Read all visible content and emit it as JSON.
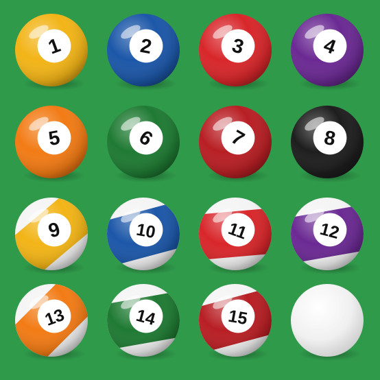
{
  "colors": {
    "felt": "#2f9a4a",
    "yellow": "#f2b417",
    "blue": "#1c57a8",
    "red": "#d8272b",
    "purple": "#6b2a93",
    "orange": "#f27b15",
    "green": "#1f7a33",
    "maroon": "#b81f24",
    "black": "#1e1e1e",
    "white": "#f2f2f2"
  },
  "balls": [
    {
      "number": "1",
      "type": "solid",
      "color": "yellow"
    },
    {
      "number": "2",
      "type": "solid",
      "color": "blue"
    },
    {
      "number": "3",
      "type": "solid",
      "color": "red"
    },
    {
      "number": "4",
      "type": "solid",
      "color": "purple"
    },
    {
      "number": "5",
      "type": "solid",
      "color": "orange"
    },
    {
      "number": "6",
      "type": "solid",
      "color": "green"
    },
    {
      "number": "7",
      "type": "solid",
      "color": "maroon"
    },
    {
      "number": "8",
      "type": "solid",
      "color": "black"
    },
    {
      "number": "9",
      "type": "stripe",
      "color": "yellow"
    },
    {
      "number": "10",
      "type": "stripe",
      "color": "blue"
    },
    {
      "number": "11",
      "type": "stripe",
      "color": "red"
    },
    {
      "number": "12",
      "type": "stripe",
      "color": "purple"
    },
    {
      "number": "13",
      "type": "stripe",
      "color": "orange"
    },
    {
      "number": "14",
      "type": "stripe",
      "color": "green"
    },
    {
      "number": "15",
      "type": "stripe",
      "color": "maroon"
    },
    {
      "number": "",
      "type": "cue",
      "color": "white"
    }
  ]
}
